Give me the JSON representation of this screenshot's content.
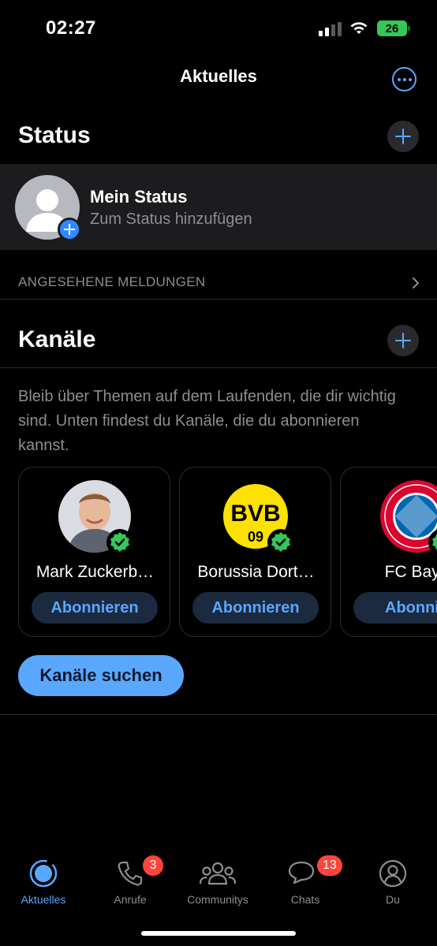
{
  "status_bar": {
    "time": "02:27",
    "battery": "26"
  },
  "header": {
    "title": "Aktuelles",
    "more_icon": "more-icon"
  },
  "status": {
    "section_title": "Status",
    "my_status": {
      "name": "Mein Status",
      "subtitle": "Zum Status hinzufügen"
    },
    "viewed_label": "ANGESEHENE MELDUNGEN"
  },
  "channels": {
    "section_title": "Kanäle",
    "description": "Bleib über Themen auf dem Laufenden, die dir wichtig sind. Unten findest du Kanäle, die du abonnieren kannst.",
    "cards": [
      {
        "name": "Mark Zuckerb…",
        "button": "Abonnieren"
      },
      {
        "name": "Borussia Dort…",
        "button": "Abonnieren"
      },
      {
        "name": "FC Baye",
        "button": "Abonnie"
      }
    ],
    "search_button": "Kanäle suchen",
    "bvb_logo_text": "BVB 09"
  },
  "tabbar": {
    "tabs": [
      {
        "label": "Aktuelles",
        "icon": "updates-icon"
      },
      {
        "label": "Anrufe",
        "icon": "phone-icon",
        "badge": "3"
      },
      {
        "label": "Communitys",
        "icon": "communities-icon"
      },
      {
        "label": "Chats",
        "icon": "chats-icon",
        "badge": "13"
      },
      {
        "label": "Du",
        "icon": "profile-icon"
      }
    ]
  },
  "colors": {
    "accent": "#5aa7ff",
    "badge": "#ff453a",
    "verified": "#34c759",
    "battery": "#34c759"
  }
}
